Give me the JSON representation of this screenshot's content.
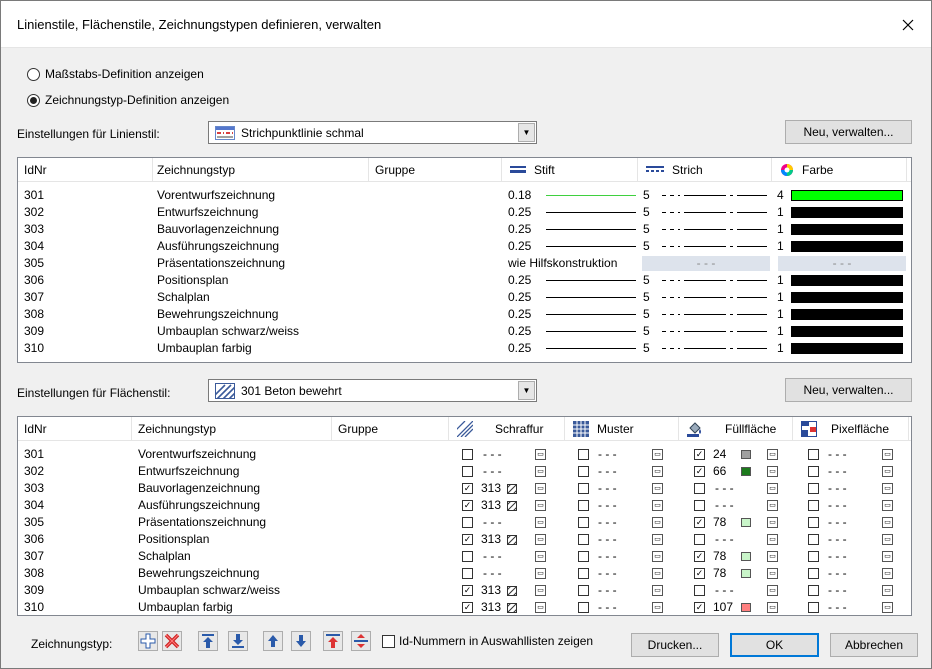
{
  "title": "Linienstile, Flächenstile, Zeichnungstypen definieren, verwalten",
  "radio": {
    "opt1": "Maßstabs-Definition anzeigen",
    "opt2": "Zeichnungstyp-Definition anzeigen",
    "selected": "opt2"
  },
  "linestyle": {
    "label": "Einstellungen für Linienstil:",
    "value": "Strichpunktlinie schmal",
    "button": "Neu, verwalten..."
  },
  "fillstyle": {
    "label": "Einstellungen für Flächenstil:",
    "value": "301 Beton bewehrt",
    "button": "Neu, verwalten..."
  },
  "table1": {
    "headers": {
      "id": "IdNr",
      "type": "Zeichnungstyp",
      "group": "Gruppe",
      "pen": "Stift",
      "stroke": "Strich",
      "color": "Farbe"
    },
    "rows": [
      {
        "id": "301",
        "type": "Vorentwurfszeichnung",
        "pen": "0.18",
        "stroke": "5",
        "color": "4",
        "hex": "#00ff00"
      },
      {
        "id": "302",
        "type": "Entwurfszeichnung",
        "pen": "0.25",
        "stroke": "5",
        "color": "1",
        "hex": "#000000"
      },
      {
        "id": "303",
        "type": "Bauvorlagenzeichnung",
        "pen": "0.25",
        "stroke": "5",
        "color": "1",
        "hex": "#000000"
      },
      {
        "id": "304",
        "type": "Ausführungszeichnung",
        "pen": "0.25",
        "stroke": "5",
        "color": "1",
        "hex": "#000000"
      },
      {
        "id": "305",
        "type": "Präsentationszeichnung",
        "pen": "wie Hilfskonstruktion",
        "special": true
      },
      {
        "id": "306",
        "type": "Positionsplan",
        "pen": "0.25",
        "stroke": "5",
        "color": "1",
        "hex": "#000000"
      },
      {
        "id": "307",
        "type": "Schalplan",
        "pen": "0.25",
        "stroke": "5",
        "color": "1",
        "hex": "#000000"
      },
      {
        "id": "308",
        "type": "Bewehrungszeichnung",
        "pen": "0.25",
        "stroke": "5",
        "color": "1",
        "hex": "#000000"
      },
      {
        "id": "309",
        "type": "Umbauplan schwarz/weiss",
        "pen": "0.25",
        "stroke": "5",
        "color": "1",
        "hex": "#000000"
      },
      {
        "id": "310",
        "type": "Umbauplan farbig",
        "pen": "0.25",
        "stroke": "5",
        "color": "1",
        "hex": "#000000"
      }
    ]
  },
  "table2": {
    "headers": {
      "id": "IdNr",
      "type": "Zeichnungstyp",
      "group": "Gruppe",
      "hatch": "Schraffur",
      "pattern": "Muster",
      "fill": "Füllfläche",
      "pixel": "Pixelfläche"
    },
    "rows": [
      {
        "id": "301",
        "type": "Vorentwurfszeichnung",
        "hatch": "",
        "fill": "24",
        "fillColor": "#a0a0a0"
      },
      {
        "id": "302",
        "type": "Entwurfszeichnung",
        "hatch": "",
        "fill": "66",
        "fillColor": "#1c7a1c"
      },
      {
        "id": "303",
        "type": "Bauvorlagenzeichnung",
        "hatch": "313",
        "fill": ""
      },
      {
        "id": "304",
        "type": "Ausführungszeichnung",
        "hatch": "313",
        "fill": ""
      },
      {
        "id": "305",
        "type": "Präsentationszeichnung",
        "hatch": "",
        "fill": "78",
        "fillColor": "#c9f5c9"
      },
      {
        "id": "306",
        "type": "Positionsplan",
        "hatch": "313",
        "fill": ""
      },
      {
        "id": "307",
        "type": "Schalplan",
        "hatch": "",
        "fill": "78",
        "fillColor": "#c9f5c9"
      },
      {
        "id": "308",
        "type": "Bewehrungszeichnung",
        "hatch": "",
        "fill": "78",
        "fillColor": "#c9f5c9"
      },
      {
        "id": "309",
        "type": "Umbauplan schwarz/weiss",
        "hatch": "313",
        "fill": ""
      },
      {
        "id": "310",
        "type": "Umbauplan farbig",
        "hatch": "313",
        "fill": "107",
        "fillColor": "#ff8080"
      }
    ]
  },
  "dash": "- - -",
  "bottom": {
    "label": "Zeichnungstyp:",
    "checkbox": "Id-Nummern in Auswahllisten zeigen",
    "print": "Drucken...",
    "ok": "OK",
    "cancel": "Abbrechen"
  }
}
